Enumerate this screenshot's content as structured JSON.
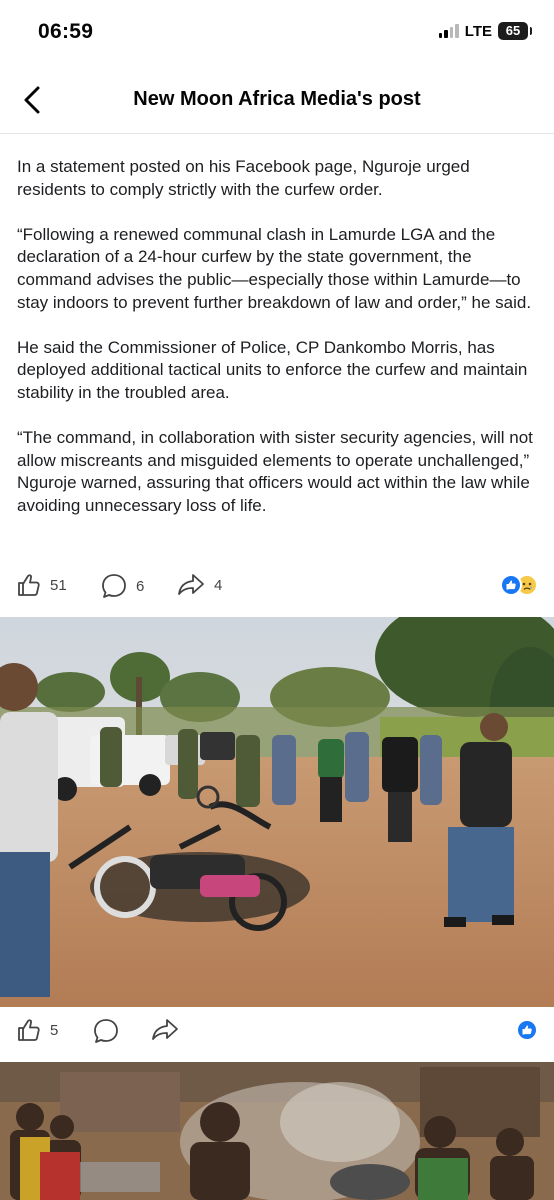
{
  "status_bar": {
    "time": "06:59",
    "network": "LTE",
    "battery": "65"
  },
  "header": {
    "title": "New Moon Africa Media's post"
  },
  "post": {
    "paragraphs": [
      "In a statement posted on his Facebook page, Nguroje urged residents to comply strictly with the curfew order.",
      "“Following a renewed communal clash in Lamurde LGA and the declaration of a 24-hour curfew by the state government, the command advises the public—especially those within Lamurde—to stay indoors to prevent further breakdown of law and order,” he said.",
      "He said the Commissioner of Police, CP Dankombo Morris, has deployed additional tactical units to enforce the curfew and maintain stability in the troubled area.",
      "“The command, in collaboration with sister security agencies, will not allow miscreants and misguided elements to operate unchallenged,” Nguroje warned, assuring that officers would act within the law while avoiding unnecessary loss of life."
    ],
    "actions": {
      "likes": "51",
      "comments": "6",
      "shares": "4"
    },
    "reaction_icons": [
      "like-icon",
      "sad-icon"
    ]
  },
  "photo1": {
    "description_icon": "photo",
    "actions": {
      "likes": "5"
    },
    "reaction_icons": [
      "like-icon"
    ]
  },
  "colors": {
    "accent": "#1877f2",
    "text": "#1c1e21",
    "divider": "#e4e6eb"
  }
}
